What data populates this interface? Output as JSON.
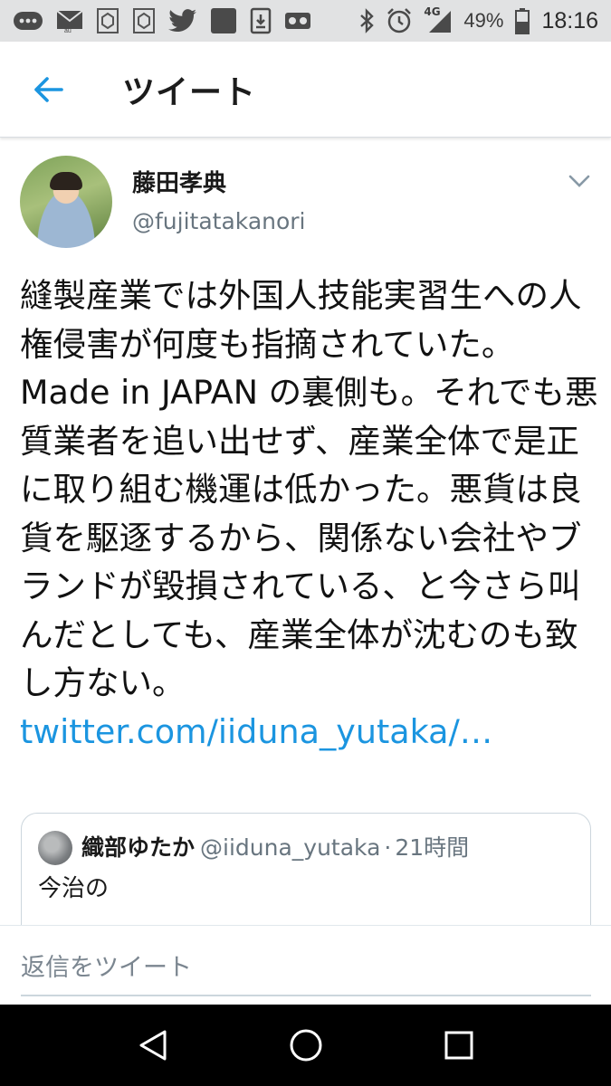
{
  "status_bar": {
    "battery": "49%",
    "time": "18:16",
    "network": "4G",
    "left_icons": [
      "chat-icon",
      "au-mail-icon",
      "cube-icon",
      "cube-icon",
      "twitter-icon",
      "square-icon",
      "download-icon",
      "voicemail-icon"
    ],
    "right_icons": [
      "bluetooth-icon",
      "alarm-icon",
      "signal-icon",
      "battery-icon"
    ]
  },
  "header": {
    "title": "ツイート",
    "back_icon": "arrow-left-icon"
  },
  "tweet": {
    "author_name": "藤田孝典",
    "author_handle": "@fujitatakanori",
    "text": "縫製産業では外国人技能実習生への人権侵害が何度も指摘されていた。Made in JAPAN の裏側も。それでも悪質業者を追い出せず、産業全体で是正に取り組む機運は低かった。悪貨は良貨を駆逐するから、関係ない会社やブランドが毀損されている、と今さら叫んだとしても、産業全体が沈むのも致し方ない。",
    "link": "twitter.com/iiduna_yutaka/…"
  },
  "quote": {
    "name": "織部ゆたか",
    "handle": "@iiduna_yutaka",
    "separator": "·",
    "time": "21時間",
    "text": "今治の"
  },
  "reply": {
    "placeholder": "返信をツイート"
  },
  "nav_bar": {
    "buttons": [
      "back-triangle-icon",
      "home-circle-icon",
      "recents-square-icon"
    ]
  },
  "colors": {
    "accent": "#1b95e0",
    "status_bar_bg": "#e1e2e3",
    "secondary_text": "#68757f"
  }
}
